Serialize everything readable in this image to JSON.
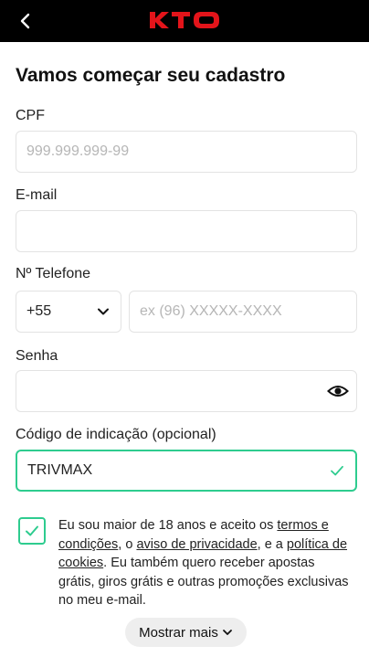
{
  "header": {
    "logo_text": "KTO",
    "brand_color": "#e3141a",
    "back_icon": "chevron-left-icon"
  },
  "form": {
    "title": "Vamos começar seu cadastro",
    "cpf": {
      "label": "CPF",
      "placeholder": "999.999.999-99",
      "value": ""
    },
    "email": {
      "label": "E-mail",
      "placeholder": "",
      "value": ""
    },
    "phone": {
      "label": "Nº Telefone",
      "country_code": "+55",
      "placeholder": "ex (96) XXXXX-XXXX",
      "value": ""
    },
    "password": {
      "label": "Senha",
      "value": "",
      "icon": "eye-icon"
    },
    "referral": {
      "label": "Código de indicação (opcional)",
      "value": "TRIVMAX",
      "icon": "check-icon"
    },
    "accent_color": "#2ecc8f"
  },
  "consent": {
    "checked": true,
    "text_1": "Eu sou maior de 18 anos e aceito os ",
    "link_terms": "termos e condições",
    "text_2": ", o ",
    "link_privacy": "aviso de privacidade",
    "text_3": ", e a ",
    "link_cookies": "política de cookies",
    "text_4": ". Eu também quero receber apostas grátis, giros grátis e outras promoções exclusivas no meu e-mail."
  },
  "show_more": {
    "label": "Mostrar mais"
  }
}
